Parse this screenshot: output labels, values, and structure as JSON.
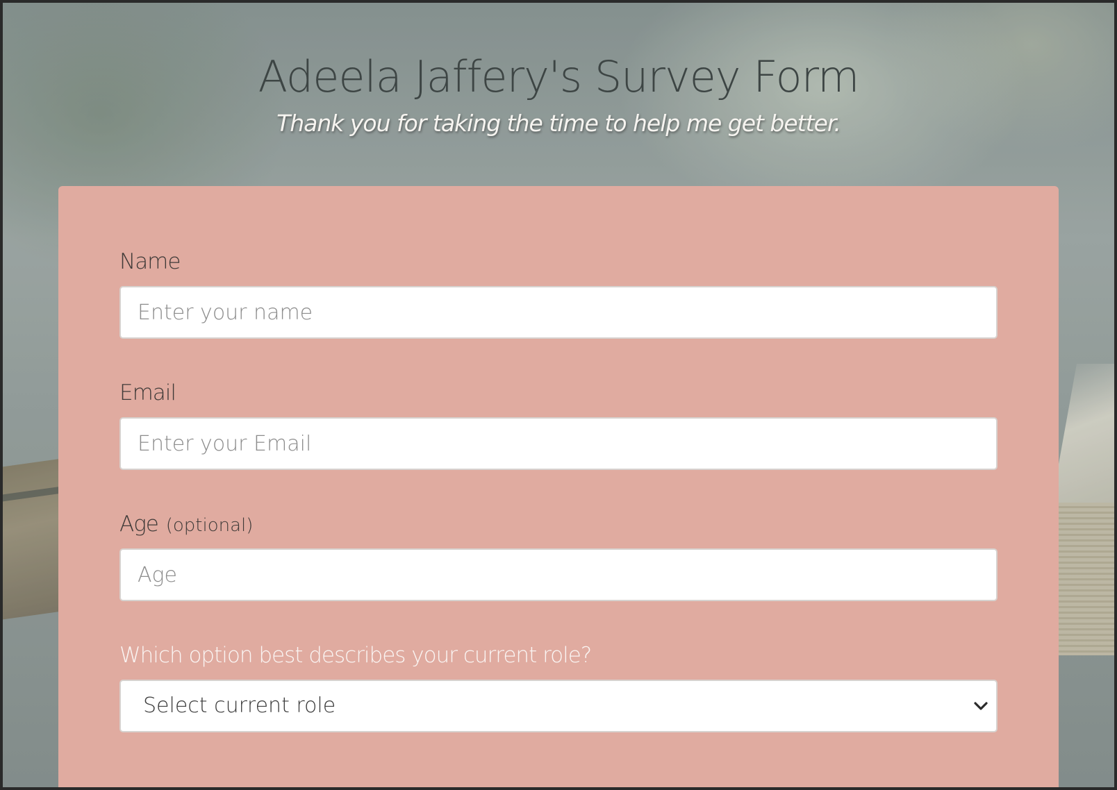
{
  "header": {
    "title": "Adeela Jaffery's Survey Form",
    "subtitle": "Thank you for taking the time to help me get better."
  },
  "form": {
    "name": {
      "label": "Name",
      "placeholder": "Enter your name",
      "value": ""
    },
    "email": {
      "label": "Email",
      "placeholder": "Enter your Email",
      "value": ""
    },
    "age": {
      "label": "Age",
      "label_suffix": "(optional)",
      "placeholder": "Age",
      "value": ""
    },
    "role": {
      "label": "Which option best describes your current role?",
      "selected": "Select current role",
      "icon": "chevron-down-icon"
    }
  },
  "colors": {
    "card_background": "#e0aba0",
    "title_color": "#3d4544",
    "subtitle_color": "#f6f4f0",
    "input_background": "#ffffff"
  }
}
